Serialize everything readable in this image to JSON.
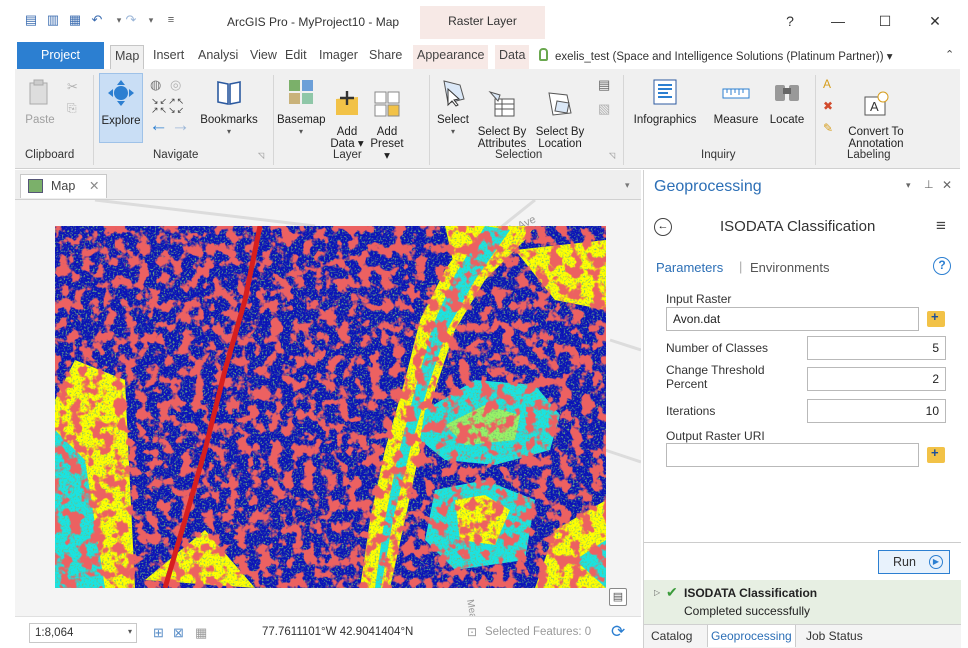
{
  "window": {
    "title": "ArcGIS Pro - MyProject10 - Map",
    "context_tab": "Raster Layer",
    "help": "?",
    "minimize": "—",
    "maximize": "☐",
    "close": "✕"
  },
  "tabs": [
    "Project",
    "Map",
    "Insert",
    "Analysi",
    "View",
    "Edit",
    "Imager",
    "Share",
    "Appearance",
    "Data"
  ],
  "user": "exelis_test (Space and Intelligence Solutions (Platinum Partner)) ▾",
  "ribbon": {
    "paste": "Paste",
    "explore": "Explore",
    "bookmarks": "Bookmarks",
    "basemap": "Basemap",
    "add_data": "Add\nData ▾",
    "add_preset": "Add\nPreset ▾",
    "select": "Select",
    "select_by_attributes": "Select By\nAttributes",
    "select_by_location": "Select By\nLocation",
    "infographics": "Infographics",
    "measure": "Measure",
    "locate": "Locate",
    "convert_to_annotation": "Convert To\nAnnotation",
    "groups": [
      "Clipboard",
      "Navigate",
      "Layer",
      "Selection",
      "Inquiry",
      "Labeling"
    ]
  },
  "map": {
    "tab_label": "Map",
    "road_labels": [
      "North Ave",
      "Meadow"
    ],
    "scale": "1:8,064",
    "coordinates": "77.7611101°W 42.9041404°N",
    "selected_features": "Selected Features: 0"
  },
  "geoprocessing": {
    "pane_title": "Geoprocessing",
    "tool_title": "ISODATA Classification",
    "tab_parameters": "Parameters",
    "tab_environments": "Environments",
    "input_raster_label": "Input Raster",
    "input_raster_value": "Avon.dat",
    "num_classes_label": "Number of Classes",
    "num_classes_value": "5",
    "change_threshold_label": "Change Threshold\nPercent",
    "change_threshold_value": "2",
    "iterations_label": "Iterations",
    "iterations_value": "10",
    "output_raster_label": "Output Raster URI",
    "output_raster_value": "",
    "run_label": "Run",
    "result_title": "ISODATA Classification",
    "result_status": "Completed successfully"
  },
  "bottom_tabs": [
    "Catalog",
    "Geoprocessing",
    "Job Status"
  ],
  "colors": {
    "accent_blue": "#2c7fd1",
    "context_pink": "#f7e9e6",
    "class_blue": "#0b13b8",
    "class_red": "#d61f1f",
    "class_green": "#2f7a2f",
    "class_yellow": "#ffff00",
    "class_cyan": "#19e3e3"
  }
}
